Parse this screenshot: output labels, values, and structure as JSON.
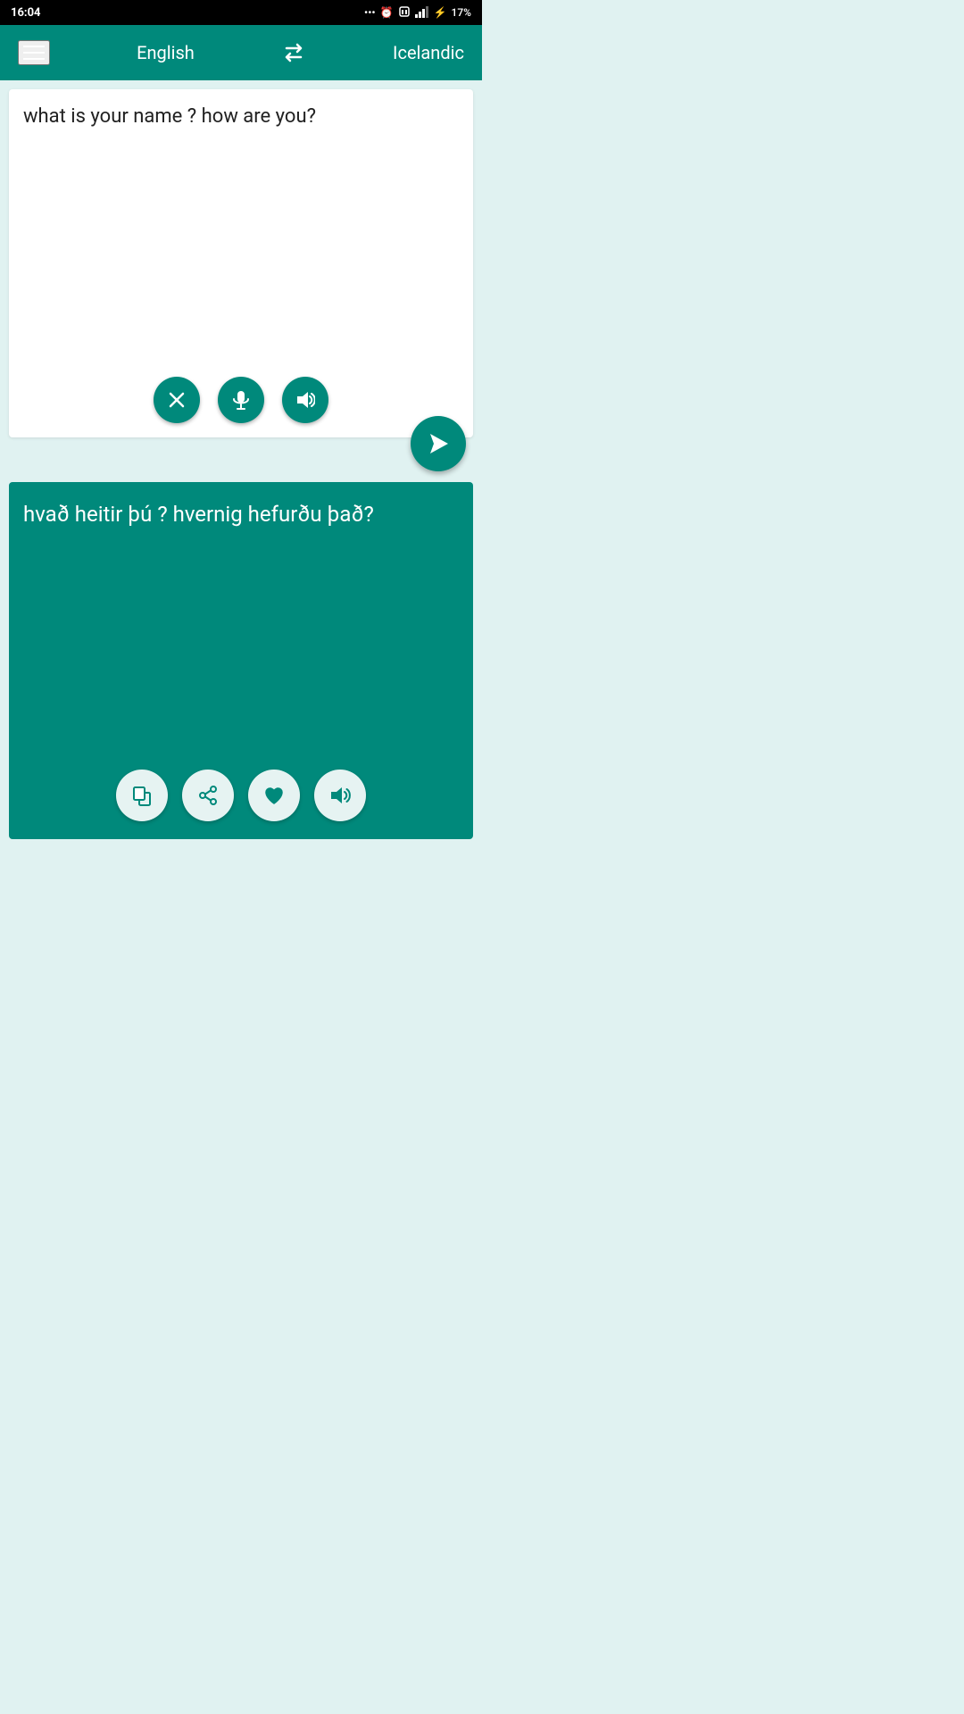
{
  "status_bar": {
    "time": "16:04",
    "battery": "17%"
  },
  "header": {
    "source_lang": "English",
    "target_lang": "Icelandic",
    "swap_icon": "⇄"
  },
  "input_panel": {
    "text": "what is your name ? how are you?",
    "clear_btn": "✕",
    "mic_btn": "🎤",
    "speaker_btn": "🔊"
  },
  "send_btn": "▶",
  "output_panel": {
    "text": "hvað heitir þú ? hvernig hefurðu það?",
    "copy_btn": "⧉",
    "share_btn": "↗",
    "favorite_btn": "♥",
    "speaker_btn": "🔊"
  }
}
